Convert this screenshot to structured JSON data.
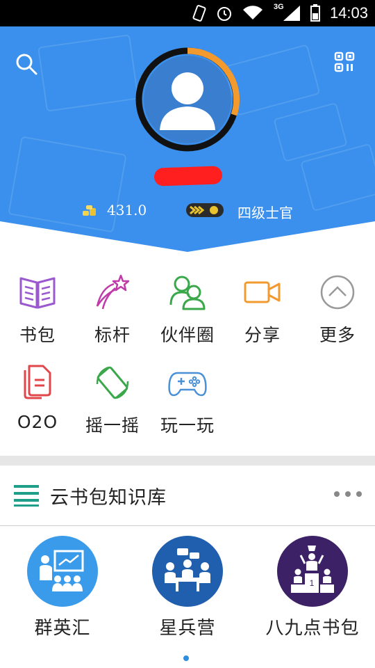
{
  "status_bar": {
    "time": "14:03",
    "network": "3G"
  },
  "profile": {
    "points": "431.0",
    "rank": "四级士官"
  },
  "features": [
    {
      "label": "书包",
      "icon": "book-icon",
      "color": "#9b59d0"
    },
    {
      "label": "标杆",
      "icon": "shooting-star-icon",
      "color": "#c03aa8"
    },
    {
      "label": "伙伴圈",
      "icon": "partners-icon",
      "color": "#3aa84a"
    },
    {
      "label": "分享",
      "icon": "video-icon",
      "color": "#f29a2e"
    },
    {
      "label": "更多",
      "icon": "chevron-up-icon",
      "color": "#999999"
    },
    {
      "label": "O2O",
      "icon": "documents-icon",
      "color": "#e0464a"
    },
    {
      "label": "摇一摇",
      "icon": "rotate-phone-icon",
      "color": "#3aa84a"
    },
    {
      "label": "玩一玩",
      "icon": "gamepad-icon",
      "color": "#4a90d6"
    }
  ],
  "knowledge_base": {
    "title": "云书包知识库",
    "items": [
      {
        "label": "群英汇",
        "icon": "presentation-icon",
        "color": "#3a90ec"
      },
      {
        "label": "星兵营",
        "icon": "meeting-icon",
        "color": "#1f5fae"
      },
      {
        "label": "八九点书包",
        "icon": "podium-icon",
        "color": "#3d2166"
      }
    ]
  },
  "colors": {
    "hero": "#3a90ec",
    "accent": "#f29a2e",
    "redaction": "#ff1f1f"
  }
}
